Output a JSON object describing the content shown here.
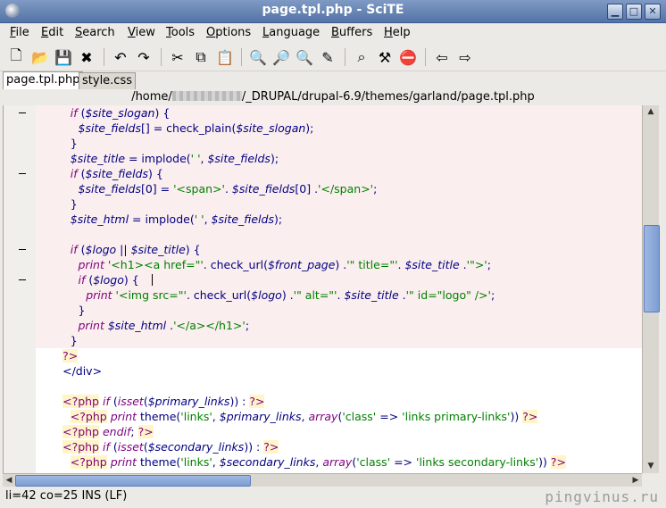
{
  "window": {
    "title": "page.tpl.php - SciTE"
  },
  "menu": [
    {
      "underline": "F",
      "rest": "ile"
    },
    {
      "underline": "E",
      "rest": "dit"
    },
    {
      "underline": "S",
      "rest": "earch"
    },
    {
      "underline": "V",
      "rest": "iew"
    },
    {
      "underline": "T",
      "rest": "ools"
    },
    {
      "underline": "O",
      "rest": "ptions"
    },
    {
      "underline": "L",
      "rest": "anguage"
    },
    {
      "underline": "B",
      "rest": "uffers"
    },
    {
      "underline": "H",
      "rest": "elp"
    }
  ],
  "toolbar": [
    {
      "icon": "new-file-icon",
      "glyph": "🗋"
    },
    {
      "icon": "open-folder-icon",
      "glyph": "📂"
    },
    {
      "icon": "save-icon",
      "glyph": "💾"
    },
    {
      "icon": "close-icon",
      "glyph": "✖"
    },
    {
      "icon": "undo-icon",
      "glyph": "↶"
    },
    {
      "icon": "redo-icon",
      "glyph": "↷"
    },
    {
      "icon": "cut-icon",
      "glyph": "✂"
    },
    {
      "icon": "copy-icon",
      "glyph": "⧉"
    },
    {
      "icon": "paste-icon",
      "glyph": "📋"
    },
    {
      "icon": "find-icon",
      "glyph": "🔍"
    },
    {
      "icon": "find-next-icon",
      "glyph": "🔎"
    },
    {
      "icon": "find-in-files-icon",
      "glyph": "🔍"
    },
    {
      "icon": "replace-icon",
      "glyph": "✎"
    },
    {
      "icon": "binoculars-icon",
      "glyph": "⌕"
    },
    {
      "icon": "build-icon",
      "glyph": "⚒"
    },
    {
      "icon": "stop-icon",
      "glyph": "⛔"
    },
    {
      "icon": "previous-buffer-icon",
      "glyph": "⇦"
    },
    {
      "icon": "next-buffer-icon",
      "glyph": "⇨"
    }
  ],
  "tabs": [
    {
      "label": "page.tpl.php",
      "active": true
    },
    {
      "label": "style.css",
      "active": false
    }
  ],
  "path": {
    "prefix": "/home/",
    "suffix": "/_DRUPAL/drupal-6.9/themes/garland/page.tpl.php"
  },
  "editor": {
    "lines": [
      {
        "fold": true,
        "marker": true,
        "indent": 4,
        "tokens": [
          [
            "k",
            "if"
          ],
          [
            "t",
            " ("
          ],
          [
            "v",
            "$site_slogan"
          ],
          [
            "t",
            ") {"
          ]
        ]
      },
      {
        "fold": true,
        "indent": 5,
        "tokens": [
          [
            "v",
            "$site_fields"
          ],
          [
            "t",
            "[] = check_plain("
          ],
          [
            "v",
            "$site_slogan"
          ],
          [
            "t",
            ");"
          ]
        ]
      },
      {
        "fold": true,
        "indent": 4,
        "tokens": [
          [
            "t",
            "}"
          ]
        ]
      },
      {
        "fold": true,
        "indent": 4,
        "tokens": [
          [
            "v",
            "$site_title"
          ],
          [
            "t",
            " = implode("
          ],
          [
            "s",
            "' '"
          ],
          [
            "t",
            ", "
          ],
          [
            "v",
            "$site_fields"
          ],
          [
            "t",
            ");"
          ]
        ]
      },
      {
        "fold": true,
        "marker": true,
        "indent": 4,
        "tokens": [
          [
            "k",
            "if"
          ],
          [
            "t",
            " ("
          ],
          [
            "v",
            "$site_fields"
          ],
          [
            "t",
            ") {"
          ]
        ]
      },
      {
        "fold": true,
        "indent": 5,
        "tokens": [
          [
            "v",
            "$site_fields"
          ],
          [
            "t",
            "[0] = "
          ],
          [
            "s",
            "'<span>'"
          ],
          [
            "t",
            ". "
          ],
          [
            "v",
            "$site_fields"
          ],
          [
            "t",
            "[0] ."
          ],
          [
            "s",
            "'</span>'"
          ],
          [
            "t",
            ";"
          ]
        ]
      },
      {
        "fold": true,
        "indent": 4,
        "tokens": [
          [
            "t",
            "}"
          ]
        ]
      },
      {
        "fold": true,
        "indent": 4,
        "tokens": [
          [
            "v",
            "$site_html"
          ],
          [
            "t",
            " = implode("
          ],
          [
            "s",
            "' '"
          ],
          [
            "t",
            ", "
          ],
          [
            "v",
            "$site_fields"
          ],
          [
            "t",
            ");"
          ]
        ]
      },
      {
        "fold": true,
        "indent": 0,
        "tokens": []
      },
      {
        "fold": true,
        "marker": true,
        "indent": 4,
        "tokens": [
          [
            "k",
            "if"
          ],
          [
            "t",
            " ("
          ],
          [
            "v",
            "$logo"
          ],
          [
            "t",
            " || "
          ],
          [
            "v",
            "$site_title"
          ],
          [
            "t",
            ") {"
          ]
        ]
      },
      {
        "fold": true,
        "indent": 5,
        "tokens": [
          [
            "k",
            "print"
          ],
          [
            "t",
            " "
          ],
          [
            "s",
            "'<h1><a href=\"'"
          ],
          [
            "t",
            ". check_url("
          ],
          [
            "v",
            "$front_page"
          ],
          [
            "t",
            ") ."
          ],
          [
            "s",
            "'\" title=\"'"
          ],
          [
            "t",
            ". "
          ],
          [
            "v",
            "$site_title"
          ],
          [
            "t",
            " ."
          ],
          [
            "s",
            "'\">'"
          ],
          [
            "t",
            ";"
          ]
        ]
      },
      {
        "fold": true,
        "marker": true,
        "indent": 5,
        "tokens": [
          [
            "k",
            "if"
          ],
          [
            "t",
            " ("
          ],
          [
            "v",
            "$logo"
          ],
          [
            "t",
            ") {"
          ]
        ]
      },
      {
        "fold": true,
        "indent": 6,
        "tokens": [
          [
            "k",
            "print"
          ],
          [
            "t",
            " "
          ],
          [
            "s",
            "'<img src=\"'"
          ],
          [
            "t",
            ". check_url("
          ],
          [
            "v",
            "$logo"
          ],
          [
            "t",
            ") ."
          ],
          [
            "s",
            "'\" alt=\"'"
          ],
          [
            "t",
            ". "
          ],
          [
            "v",
            "$site_title"
          ],
          [
            "t",
            " ."
          ],
          [
            "s",
            "'\" id=\"logo\" />'"
          ],
          [
            "t",
            ";"
          ]
        ]
      },
      {
        "fold": true,
        "indent": 5,
        "tokens": [
          [
            "t",
            "}"
          ]
        ]
      },
      {
        "fold": true,
        "indent": 5,
        "tokens": [
          [
            "k",
            "print"
          ],
          [
            "t",
            " "
          ],
          [
            "v",
            "$site_html"
          ],
          [
            "t",
            " ."
          ],
          [
            "s",
            "'</a></h1>'"
          ],
          [
            "t",
            ";"
          ]
        ]
      },
      {
        "fold": true,
        "indent": 4,
        "tokens": [
          [
            "t",
            "}"
          ]
        ]
      },
      {
        "fold": false,
        "indent": 3,
        "tokens": [
          [
            "ph",
            "?>"
          ]
        ]
      },
      {
        "fold": false,
        "indent": 3,
        "tokens": [
          [
            "t",
            "</div>"
          ]
        ]
      },
      {
        "fold": false,
        "indent": 0,
        "tokens": []
      },
      {
        "fold": false,
        "indent": 3,
        "tokens": [
          [
            "ph",
            "<?php"
          ],
          [
            "t",
            " "
          ],
          [
            "k",
            "if"
          ],
          [
            "t",
            " ("
          ],
          [
            "k",
            "isset"
          ],
          [
            "t",
            "("
          ],
          [
            "v",
            "$primary_links"
          ],
          [
            "t",
            ")) : "
          ],
          [
            "ph",
            "?>"
          ]
        ]
      },
      {
        "fold": false,
        "indent": 4,
        "tokens": [
          [
            "ph",
            "<?php"
          ],
          [
            "t",
            " "
          ],
          [
            "k",
            "print"
          ],
          [
            "t",
            " theme("
          ],
          [
            "s",
            "'links'"
          ],
          [
            "t",
            ", "
          ],
          [
            "v",
            "$primary_links"
          ],
          [
            "t",
            ", "
          ],
          [
            "k",
            "array"
          ],
          [
            "t",
            "("
          ],
          [
            "s",
            "'class'"
          ],
          [
            "t",
            " => "
          ],
          [
            "s",
            "'links primary-links'"
          ],
          [
            "t",
            ")) "
          ],
          [
            "ph",
            "?>"
          ]
        ]
      },
      {
        "fold": false,
        "indent": 3,
        "tokens": [
          [
            "ph",
            "<?php"
          ],
          [
            "t",
            " "
          ],
          [
            "k",
            "endif"
          ],
          [
            "t",
            "; "
          ],
          [
            "ph",
            "?>"
          ]
        ]
      },
      {
        "fold": false,
        "indent": 3,
        "tokens": [
          [
            "ph",
            "<?php"
          ],
          [
            "t",
            " "
          ],
          [
            "k",
            "if"
          ],
          [
            "t",
            " ("
          ],
          [
            "k",
            "isset"
          ],
          [
            "t",
            "("
          ],
          [
            "v",
            "$secondary_links"
          ],
          [
            "t",
            ")) : "
          ],
          [
            "ph",
            "?>"
          ]
        ]
      },
      {
        "fold": false,
        "indent": 4,
        "tokens": [
          [
            "ph",
            "<?php"
          ],
          [
            "t",
            " "
          ],
          [
            "k",
            "print"
          ],
          [
            "t",
            " theme("
          ],
          [
            "s",
            "'links'"
          ],
          [
            "t",
            ", "
          ],
          [
            "v",
            "$secondary_links"
          ],
          [
            "t",
            ", "
          ],
          [
            "k",
            "array"
          ],
          [
            "t",
            "("
          ],
          [
            "s",
            "'class'"
          ],
          [
            "t",
            " => "
          ],
          [
            "s",
            "'links secondary-links'"
          ],
          [
            "t",
            ")) "
          ],
          [
            "ph",
            "?>"
          ]
        ]
      }
    ]
  },
  "statusbar": {
    "text": "li=42 co=25 INS (LF)",
    "watermark": "pingvinus.ru"
  }
}
